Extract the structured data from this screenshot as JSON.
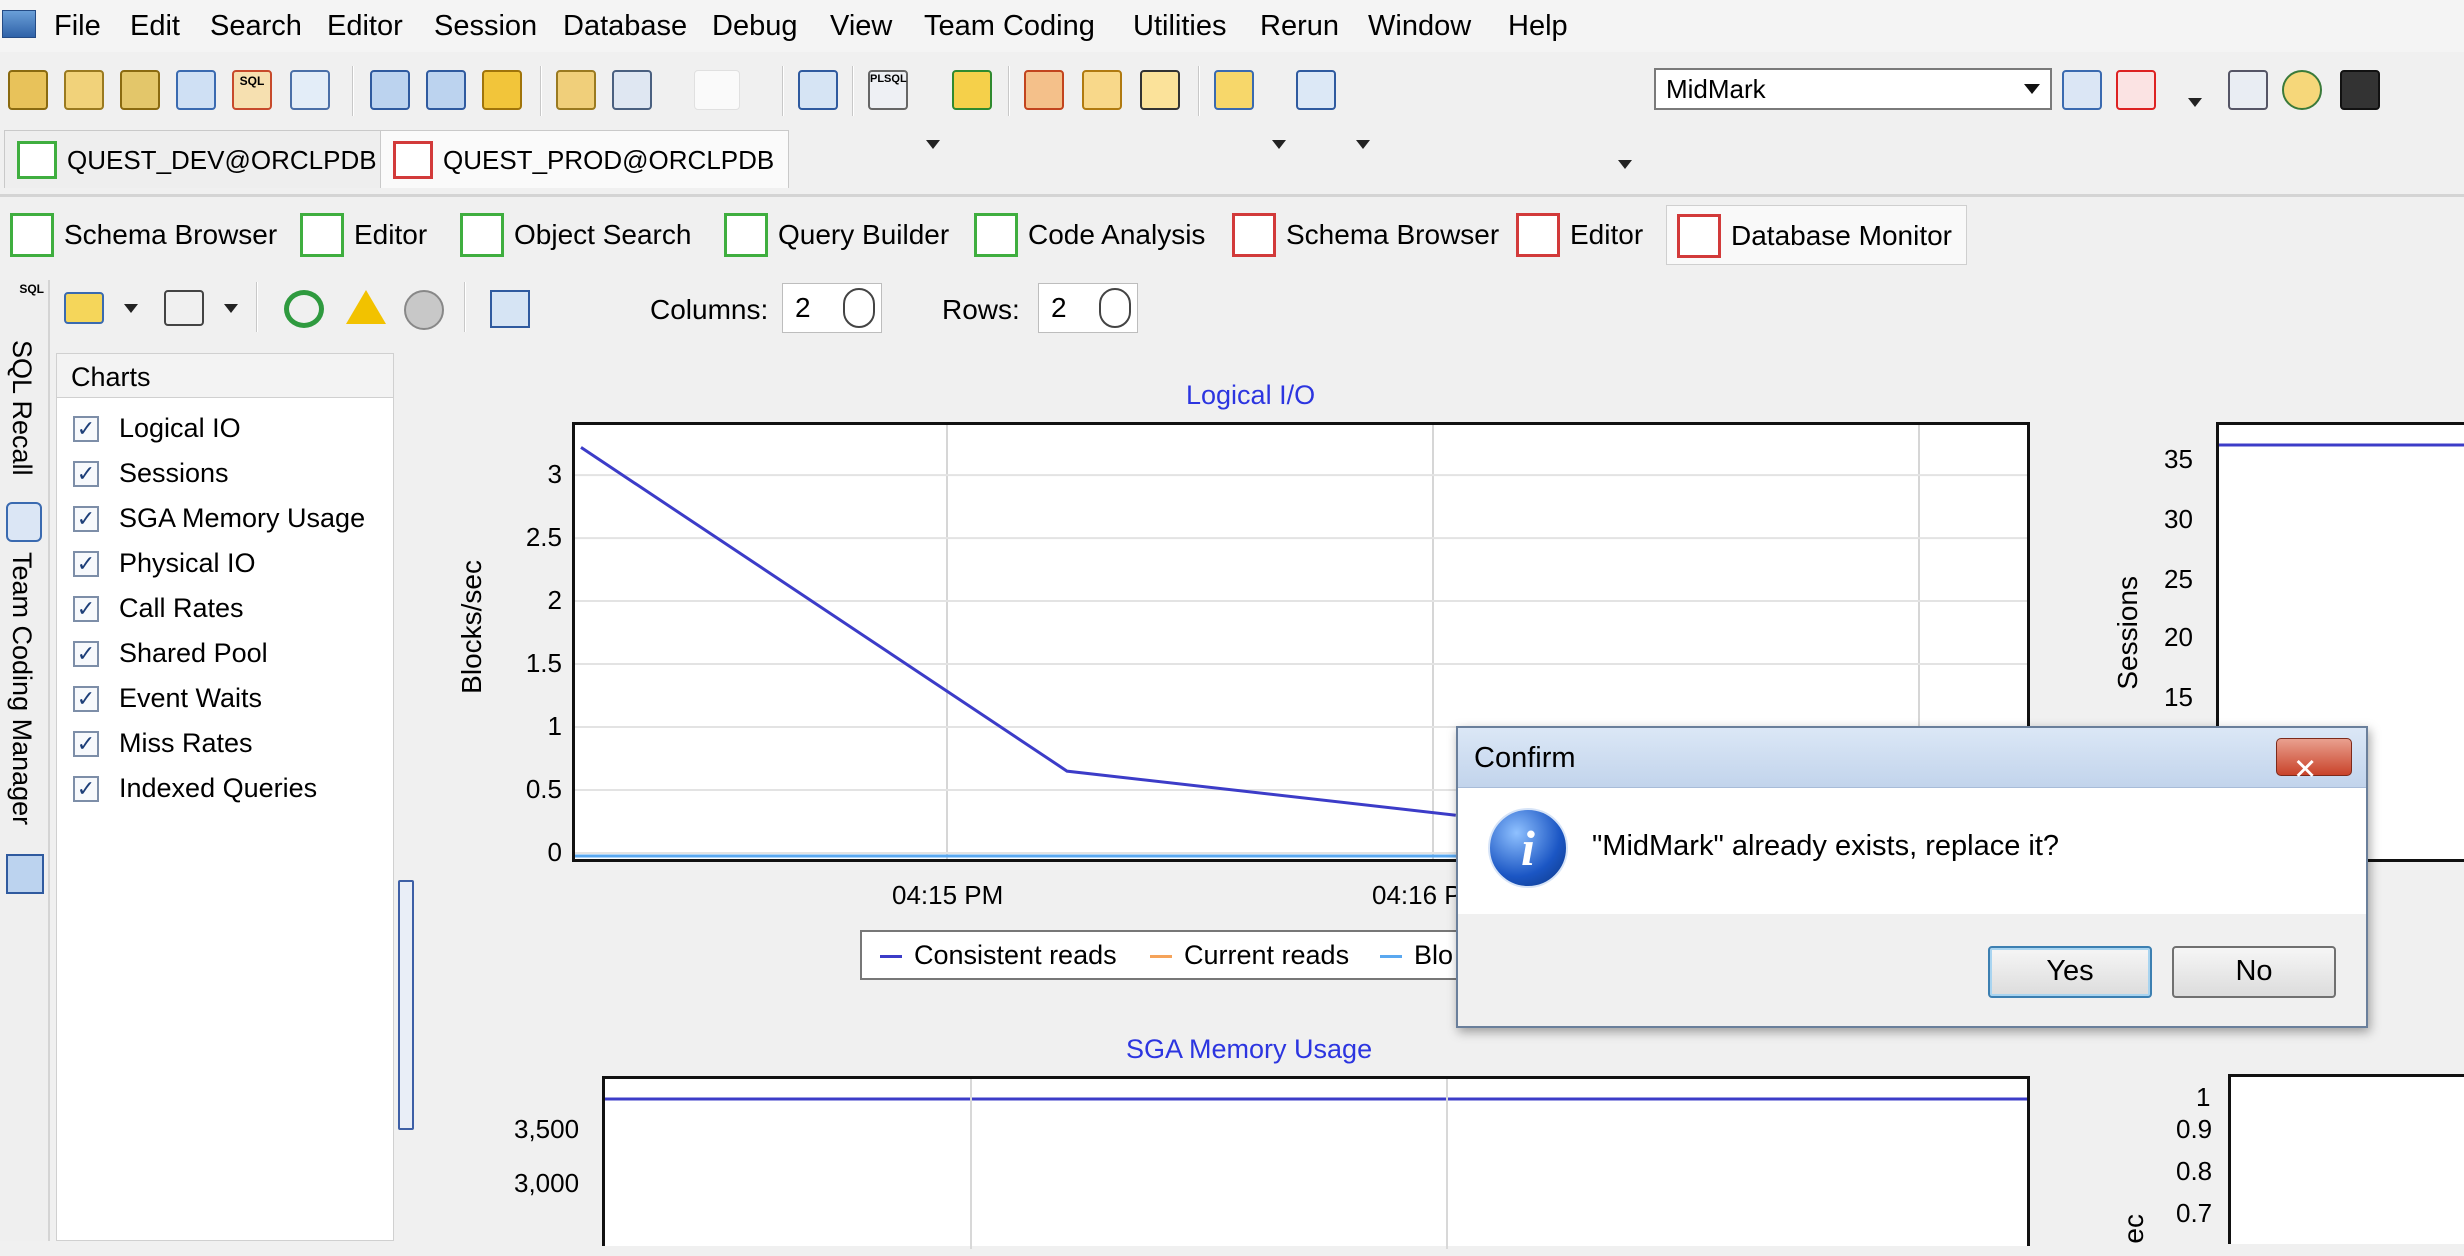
{
  "menubar": {
    "items": [
      "File",
      "Edit",
      "Search",
      "Editor",
      "Session",
      "Database",
      "Debug",
      "View",
      "Team Coding",
      "Utilities",
      "Rerun",
      "Window",
      "Help"
    ]
  },
  "toolbar": {
    "sql_icon_text": "SQL",
    "plsql_icon_text": "PLSQL",
    "profile_value": "MidMark"
  },
  "connections": [
    {
      "label": "QUEST_DEV@ORCLPDB",
      "color": "#3fae3f"
    },
    {
      "label": "QUEST_PROD@ORCLPDB",
      "color": "#d23a3a"
    }
  ],
  "window_tabs": [
    {
      "label": "Schema Browser",
      "color": "#3fae3f"
    },
    {
      "label": "Editor",
      "color": "#3fae3f"
    },
    {
      "label": "Object Search",
      "color": "#3fae3f"
    },
    {
      "label": "Query Builder",
      "color": "#3fae3f"
    },
    {
      "label": "Code Analysis",
      "color": "#3fae3f"
    },
    {
      "label": "Schema Browser",
      "color": "#d23a3a"
    },
    {
      "label": "Editor",
      "color": "#d23a3a"
    },
    {
      "label": "Database Monitor",
      "color": "#d23a3a"
    }
  ],
  "side_tabs": {
    "sql_recall": "SQL Recall",
    "team_coding": "Team Coding Manager",
    "sql_icon_text": "SQL"
  },
  "monitor": {
    "columns_label": "Columns:",
    "columns_value": "2",
    "rows_label": "Rows:",
    "rows_value": "2"
  },
  "charts_panel": {
    "header": "Charts",
    "items": [
      "Logical IO",
      "Sessions",
      "SGA Memory Usage",
      "Physical IO",
      "Call Rates",
      "Shared Pool",
      "Event Waits",
      "Miss Rates",
      "Indexed Queries"
    ],
    "check_glyph": "✓"
  },
  "chart_data": [
    {
      "type": "line",
      "title": "Logical I/O",
      "ylabel": "Blocks/sec",
      "xlabel": "",
      "x_ticks": [
        "04:15 PM",
        "04:16 P"
      ],
      "y_ticks": [
        "0",
        "0.5",
        "1",
        "1.5",
        "2",
        "2.5",
        "3"
      ],
      "ylim": [
        0,
        3.35
      ],
      "series": [
        {
          "name": "Consistent reads",
          "color": "#3c3cc8",
          "points": [
            [
              0,
              3.22
            ],
            [
              1,
              0.65
            ],
            [
              1.8,
              0.3
            ]
          ]
        },
        {
          "name": "Current reads",
          "color": "#f5a35a",
          "points": []
        },
        {
          "name": "Blo",
          "color": "#5aa8f0",
          "points": []
        }
      ]
    },
    {
      "type": "line",
      "title": "",
      "ylabel": "Sessions",
      "y_ticks": [
        "15",
        "20",
        "25",
        "30",
        "35"
      ],
      "series": [
        {
          "color": "#3c3cc8",
          "values": [
            36,
            36
          ]
        }
      ]
    },
    {
      "type": "line",
      "title": "SGA Memory Usage",
      "ylabel": "",
      "y_ticks": [
        "3,000",
        "3,500"
      ],
      "series": [
        {
          "color": "#3c3cc8",
          "values": [
            3700,
            3700
          ]
        }
      ]
    },
    {
      "type": "line",
      "title": "",
      "ylabel": "ec",
      "y_ticks": [
        "0.7",
        "0.8",
        "0.9",
        "1"
      ],
      "series": []
    }
  ],
  "dialog": {
    "title": "Confirm",
    "close_glyph": "✕",
    "message": "\"MidMark\" already exists, replace it?",
    "info_glyph": "i",
    "yes_label": "Yes",
    "no_label": "No"
  }
}
